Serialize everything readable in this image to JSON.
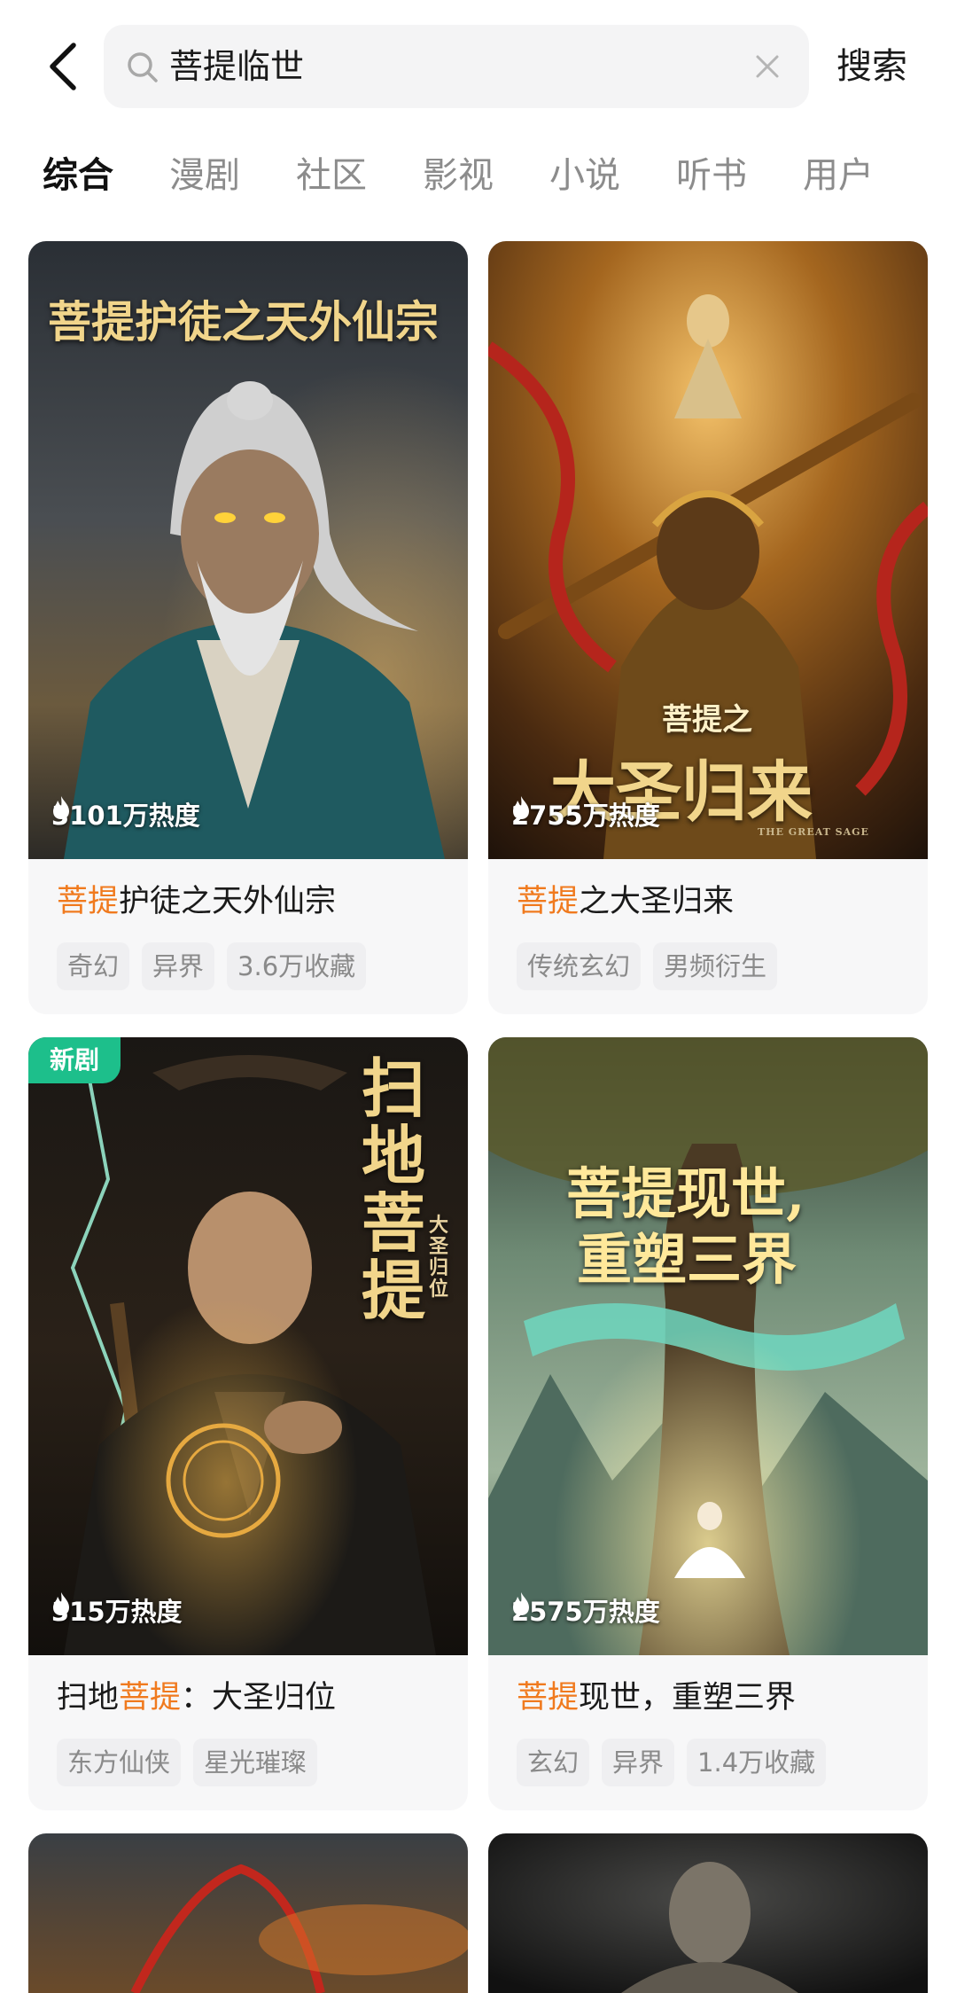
{
  "search": {
    "query": "菩提临世",
    "submit_label": "搜索"
  },
  "tabs": [
    {
      "label": "综合",
      "active": true
    },
    {
      "label": "漫剧",
      "active": false
    },
    {
      "label": "社区",
      "active": false
    },
    {
      "label": "影视",
      "active": false
    },
    {
      "label": "小说",
      "active": false
    },
    {
      "label": "听书",
      "active": false
    },
    {
      "label": "用户",
      "active": false
    }
  ],
  "cards": [
    {
      "title_highlight": "菩提",
      "title_rest": "护徒之天外仙宗",
      "poster_text": "菩提护徒之天外仙宗",
      "heat": "3101万热度",
      "tags": [
        "奇幻",
        "异界",
        "3.6万收藏"
      ]
    },
    {
      "title_highlight": "菩提",
      "title_rest": "之大圣归来",
      "poster_text_small": "菩提之",
      "poster_text": "大圣归来",
      "poster_subtext": "THE GREAT SAGE",
      "heat": "2755万热度",
      "tags": [
        "传统玄幻",
        "男频衍生"
      ]
    },
    {
      "badge": "新剧",
      "title_prefix": "扫地",
      "title_highlight": "菩提",
      "title_rest": "：大圣归位",
      "poster_text": "扫地菩提",
      "poster_subtext": "大圣归位",
      "heat": "315万热度",
      "tags": [
        "东方仙侠",
        "星光璀璨"
      ]
    },
    {
      "title_highlight": "菩提",
      "title_rest": "现世，重塑三界",
      "poster_text_line1": "菩提现世,",
      "poster_text_line2": "重塑三界",
      "heat": "2575万热度",
      "tags": [
        "玄幻",
        "异界",
        "1.4万收藏"
      ]
    }
  ],
  "colors": {
    "accent_orange": "#f07a1e",
    "new_badge_green": "#1dbf8b"
  }
}
